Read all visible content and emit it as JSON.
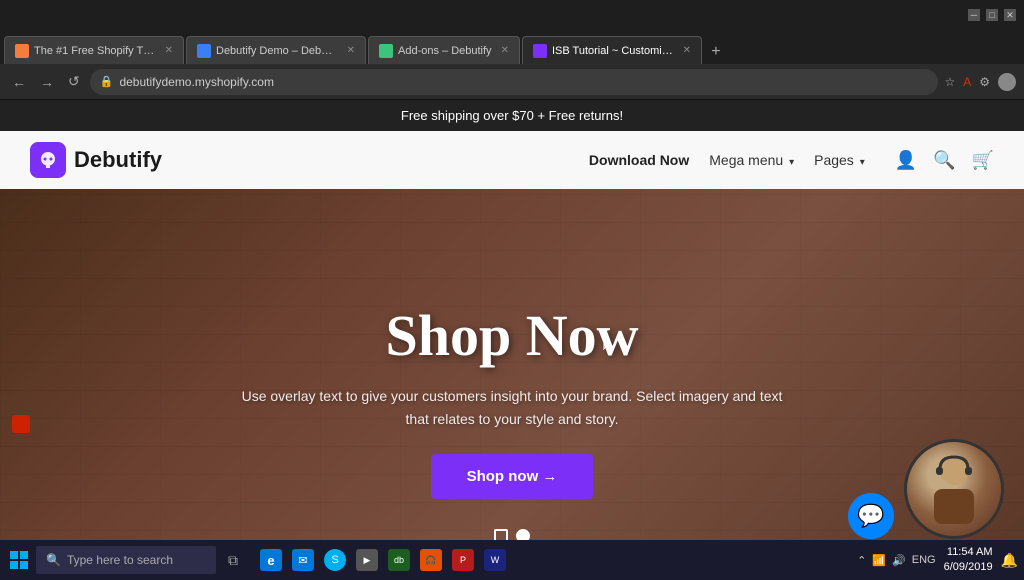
{
  "browser": {
    "tabs": [
      {
        "id": 1,
        "title": "The #1 Free Shopify Theme – De...",
        "favicon_color": "orange",
        "active": false
      },
      {
        "id": 2,
        "title": "Debutify Demo – Debutifydemo",
        "favicon_color": "blue",
        "active": false
      },
      {
        "id": 3,
        "title": "Add-ons – Debutify",
        "favicon_color": "green",
        "active": false
      },
      {
        "id": 4,
        "title": "ISB Tutorial ~ Customize ~ Deb...",
        "favicon_color": "purple",
        "active": true
      }
    ],
    "url": "debutifydemo.myshopify.com",
    "window_controls": [
      "minimize",
      "maximize",
      "close"
    ]
  },
  "website": {
    "announcement": "Free shipping over $70 + Free returns!",
    "logo_text": "Debutify",
    "nav": {
      "links": [
        "Download Now",
        "Mega menu",
        "Pages"
      ]
    },
    "hero": {
      "title": "Shop Now",
      "subtitle": "Use overlay text to give your customers insight into your brand. Select imagery and text that relates to your style and story.",
      "cta_label": "Shop now →"
    }
  },
  "taskbar": {
    "search_placeholder": "Type here to search",
    "time": "11:54 AM",
    "date": "6/09/2019",
    "lang": "ENG"
  }
}
